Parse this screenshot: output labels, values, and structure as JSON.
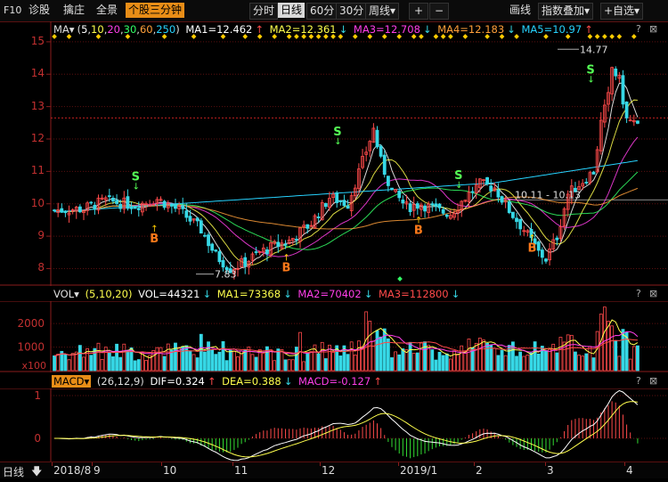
{
  "toolbar": {
    "f10": "F10",
    "diag": "诊股",
    "pick": "擒庄",
    "full": "全景",
    "stock_3min": "个股三分钟",
    "timeshare": "分时",
    "daily": "日线",
    "min60": "60分",
    "min30": "30分",
    "weekly": "周线▾",
    "plus": "+",
    "minus": "−",
    "draw": "画线",
    "index_overlay": "指数叠加▾",
    "self_select": "+自选▾"
  },
  "main": {
    "indicator": "MA▾",
    "params_open": "(",
    "p5": "5",
    "p10": "10",
    "p20": "20",
    "p30": "30",
    "p60": "60",
    "p250": "250",
    "params_close": ")",
    "ma1": "MA1=12.462",
    "ma2": "MA2=12.361",
    "ma3": "MA3=12.708",
    "ma4": "MA4=12.183",
    "ma5": "MA5=10.97",
    "y_ticks": [
      "15",
      "14",
      "13",
      "12",
      "11",
      "10",
      "9",
      "8"
    ],
    "high_label": "14.77",
    "low_label": "7.83",
    "range_label": "10.11 - 10.13",
    "buy_sign": "B",
    "sell_sign": "S"
  },
  "vol": {
    "indicator": "VOL▾",
    "params": "(5,10,20)",
    "vol": "VOL=44321",
    "ma1": "MA1=73368",
    "ma2": "MA2=70402",
    "ma3": "MA3=112800",
    "y_ticks": [
      "2000",
      "1000",
      "x100"
    ]
  },
  "macd": {
    "indicator": "MACD▾",
    "params": "(26,12,9)",
    "dif": "DIF=0.324",
    "dea": "DEA=0.388",
    "macd": "MACD=-0.127",
    "y_ticks": [
      "1",
      "0"
    ]
  },
  "footer": {
    "period": "日线",
    "months": [
      "2018/8",
      "9",
      "10",
      "11",
      "12",
      "2019/1",
      "2",
      "3",
      "4"
    ]
  },
  "colors": {
    "up": "#ff4a4a",
    "down": "#36d8e6",
    "ma5": "#ffffff",
    "ma10": "#ffff4d",
    "ma20": "#ff3ee8",
    "ma30": "#33ff66",
    "ma60": "#ff9f3a",
    "ma250": "#27d3ff",
    "grid": "#5a0f0f"
  },
  "chart_data": {
    "type": "candlestick",
    "y_range": [
      7.6,
      15.3
    ],
    "x_months": [
      "2018/8",
      "9",
      "10",
      "11",
      "12",
      "2019/1",
      "2",
      "3",
      "4"
    ],
    "annotations": [
      {
        "text": "14.77",
        "kind": "high",
        "value": 14.77
      },
      {
        "text": "7.83",
        "kind": "low",
        "value": 7.83
      },
      {
        "text": "10.11 - 10.13",
        "kind": "range"
      }
    ]
  }
}
